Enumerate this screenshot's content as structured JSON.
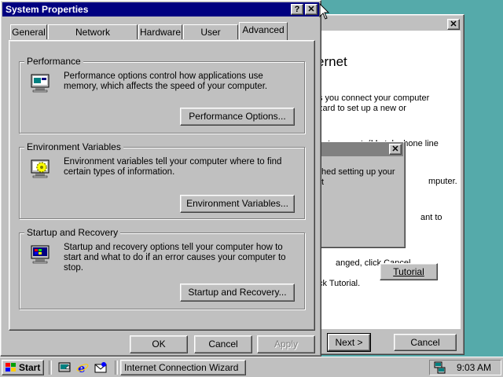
{
  "wizard": {
    "heading": "ernet",
    "lines": [
      "s you connect your computer",
      "zard to set up a new or",
      "net account. (My telephone line",
      "mputer.",
      "ant to",
      "anged, click Cancel.",
      "ck Tutorial."
    ],
    "tutorial_button": "Tutorial",
    "next_button": "Next >",
    "cancel_button": "Cancel"
  },
  "popup": {
    "lines": [
      "hed setting up your",
      "t"
    ]
  },
  "dialog": {
    "title": "System Properties",
    "help_label": "?",
    "close_label": "✕",
    "tabs": [
      "General",
      "Network Identification",
      "Hardware",
      "User Profiles",
      "Advanced"
    ],
    "active_tab": "Advanced",
    "groups": [
      {
        "title": "Performance",
        "text": "Performance options control how applications use memory, which affects the speed of your computer.",
        "button": "Performance Options...",
        "icon": "performance-monitor-icon"
      },
      {
        "title": "Environment Variables",
        "text": "Environment variables tell your computer where to find certain types of information.",
        "button": "Environment Variables...",
        "icon": "environment-gear-icon"
      },
      {
        "title": "Startup and Recovery",
        "text": "Startup and recovery options tell your computer how to start and what to do if an error causes your computer to stop.",
        "button": "Startup and Recovery...",
        "icon": "startup-monitor-icon"
      }
    ],
    "ok_button": "OK",
    "cancel_button": "Cancel",
    "apply_button": "Apply"
  },
  "taskbar": {
    "start_label": "Start",
    "task_label": "Internet Connection Wizard",
    "clock": "9:03 AM"
  },
  "colors": {
    "desktop": "#55aaaa",
    "titlebar_active": "#000080",
    "face": "#c0c0c0"
  }
}
